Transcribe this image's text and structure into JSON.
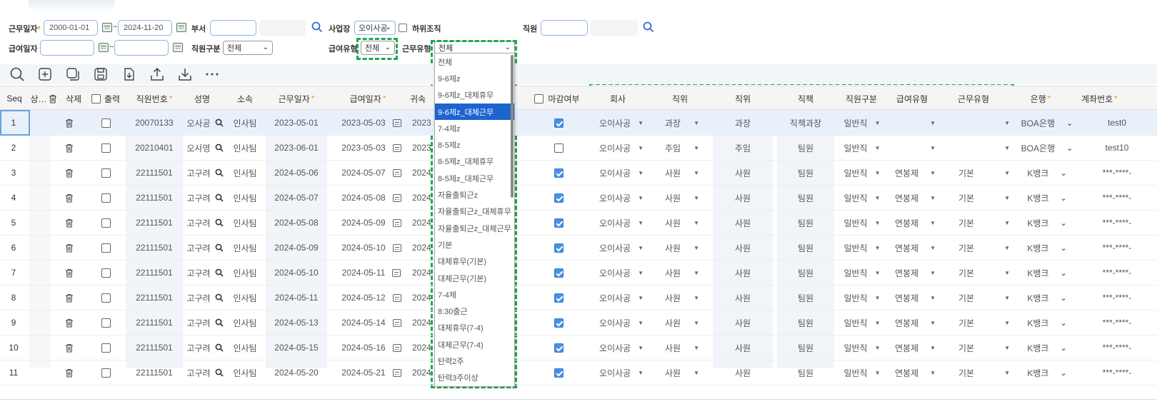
{
  "filters": {
    "work_date": {
      "label": "근무일자",
      "required_mark": "*",
      "from": "2000-01-01",
      "tilde": "~",
      "to": "2024-11-20"
    },
    "dept": {
      "label": "부서",
      "value": ""
    },
    "workplace": {
      "label": "사업장",
      "value": "오이사공"
    },
    "sub_org": {
      "label": "하위조직",
      "checked": false
    },
    "employee": {
      "label": "직원",
      "value": ""
    },
    "pay_date": {
      "label": "급여일자",
      "from": "",
      "tilde": "~",
      "to": ""
    },
    "emp_type": {
      "label": "직원구분",
      "value": "전체"
    },
    "pay_type": {
      "label": "급여유형",
      "value": "전체"
    },
    "work_type": {
      "label": "근무유형",
      "value": "전체"
    }
  },
  "toolbar": {
    "icons": [
      "search-icon",
      "add-icon",
      "copy-icon",
      "save-icon",
      "download-file-icon",
      "upload-icon",
      "download-icon",
      "more-icon"
    ]
  },
  "grid": {
    "headers": {
      "seq": "Seq",
      "status": "상…",
      "delete": "삭제",
      "print": "출력",
      "emp_no": "직원번호",
      "name": "성명",
      "affil": "소속",
      "work_date": "근무일자",
      "pay_date": "급여일자",
      "attrib": "귀속",
      "closed": "마감여부",
      "company": "회사",
      "position": "직위",
      "position2": "직위",
      "duty": "직책",
      "emp_type": "직원구분",
      "pay_type": "급여유형",
      "work_type": "근무유형",
      "bank": "은행",
      "account": "계좌번호"
    },
    "star": "*",
    "rows": [
      {
        "seq": "1",
        "emp_no": "20070133",
        "name": "오사공",
        "affil": "인사팀",
        "work_date": "2023-05-01",
        "pay_date": "2023-05-03",
        "attrib": "2023",
        "closed": true,
        "company": "오이사공",
        "position": "과장",
        "position2": "과장",
        "duty": "직책과장",
        "emp_type": "일반직",
        "pay_type": "",
        "work_type": "",
        "bank": "BOA은행",
        "account": "test0"
      },
      {
        "seq": "2",
        "emp_no": "20210401",
        "name": "오사영",
        "affil": "인사팀",
        "work_date": "2023-06-01",
        "pay_date": "2023-05-03",
        "attrib": "2023",
        "closed": false,
        "company": "오이사공",
        "position": "주임",
        "position2": "주임",
        "duty": "팀원",
        "emp_type": "일반직",
        "pay_type": "",
        "work_type": "",
        "bank": "BOA은행",
        "account": "test10"
      },
      {
        "seq": "3",
        "emp_no": "22111501",
        "name": "고구려",
        "affil": "인사팀",
        "work_date": "2024-05-06",
        "pay_date": "2024-05-07",
        "attrib": "2024",
        "closed": true,
        "company": "오이사공",
        "position": "사원",
        "position2": "사원",
        "duty": "팀원",
        "emp_type": "일반직",
        "pay_type": "연봉제",
        "work_type": "기본",
        "bank": "K뱅크",
        "account": "***-****-"
      },
      {
        "seq": "4",
        "emp_no": "22111501",
        "name": "고구려",
        "affil": "인사팀",
        "work_date": "2024-05-07",
        "pay_date": "2024-05-08",
        "attrib": "2024",
        "closed": true,
        "company": "오이사공",
        "position": "사원",
        "position2": "사원",
        "duty": "팀원",
        "emp_type": "일반직",
        "pay_type": "연봉제",
        "work_type": "기본",
        "bank": "K뱅크",
        "account": "***-****-"
      },
      {
        "seq": "5",
        "emp_no": "22111501",
        "name": "고구려",
        "affil": "인사팀",
        "work_date": "2024-05-08",
        "pay_date": "2024-05-09",
        "attrib": "2024",
        "closed": true,
        "company": "오이사공",
        "position": "사원",
        "position2": "사원",
        "duty": "팀원",
        "emp_type": "일반직",
        "pay_type": "연봉제",
        "work_type": "기본",
        "bank": "K뱅크",
        "account": "***-****-"
      },
      {
        "seq": "6",
        "emp_no": "22111501",
        "name": "고구려",
        "affil": "인사팀",
        "work_date": "2024-05-09",
        "pay_date": "2024-05-10",
        "attrib": "2024",
        "closed": true,
        "company": "오이사공",
        "position": "사원",
        "position2": "사원",
        "duty": "팀원",
        "emp_type": "일반직",
        "pay_type": "연봉제",
        "work_type": "기본",
        "bank": "K뱅크",
        "account": "***-****-"
      },
      {
        "seq": "7",
        "emp_no": "22111501",
        "name": "고구려",
        "affil": "인사팀",
        "work_date": "2024-05-10",
        "pay_date": "2024-05-11",
        "attrib": "2024",
        "closed": true,
        "company": "오이사공",
        "position": "사원",
        "position2": "사원",
        "duty": "팀원",
        "emp_type": "일반직",
        "pay_type": "연봉제",
        "work_type": "기본",
        "bank": "K뱅크",
        "account": "***-****-"
      },
      {
        "seq": "8",
        "emp_no": "22111501",
        "name": "고구려",
        "affil": "인사팀",
        "work_date": "2024-05-11",
        "pay_date": "2024-05-12",
        "attrib": "2024",
        "closed": true,
        "company": "오이사공",
        "position": "사원",
        "position2": "사원",
        "duty": "팀원",
        "emp_type": "일반직",
        "pay_type": "연봉제",
        "work_type": "기본",
        "bank": "K뱅크",
        "account": "***-****-"
      },
      {
        "seq": "9",
        "emp_no": "22111501",
        "name": "고구려",
        "affil": "인사팀",
        "work_date": "2024-05-13",
        "pay_date": "2024-05-14",
        "attrib": "2024",
        "closed": true,
        "company": "오이사공",
        "position": "사원",
        "position2": "사원",
        "duty": "팀원",
        "emp_type": "일반직",
        "pay_type": "연봉제",
        "work_type": "기본",
        "bank": "K뱅크",
        "account": "***-****-"
      },
      {
        "seq": "10",
        "emp_no": "22111501",
        "name": "고구려",
        "affil": "인사팀",
        "work_date": "2024-05-15",
        "pay_date": "2024-05-16",
        "attrib": "2024",
        "closed": true,
        "company": "오이사공",
        "position": "사원",
        "position2": "사원",
        "duty": "팀원",
        "emp_type": "일반직",
        "pay_type": "연봉제",
        "work_type": "기본",
        "bank": "K뱅크",
        "account": "***-****-"
      },
      {
        "seq": "11",
        "emp_no": "22111501",
        "name": "고구려",
        "affil": "인사팀",
        "work_date": "2024-05-20",
        "pay_date": "2024-05-21",
        "attrib": "2024",
        "closed": true,
        "company": "오이사공",
        "position": "사원",
        "position2": "사원",
        "duty": "팀원",
        "emp_type": "일반직",
        "pay_type": "연봉제",
        "work_type": "기본",
        "bank": "K뱅크",
        "account": "***-****-"
      }
    ]
  },
  "dropdown": {
    "selected": "9-6제z_대체근무",
    "options": [
      "전체",
      "9-6제z",
      "9-6제z_대체휴무",
      "9-6제z_대체근무",
      "7-4제z",
      "8-5제z",
      "8-5제z_대체휴무",
      "8-5제z_대체근무",
      "자율출퇴근z",
      "자율출퇴근z_대체휴무",
      "자율출퇴근z_대체근무",
      "기본",
      "대체휴무(기본)",
      "대체근무(기본)",
      "7-4제",
      "8:30출근",
      "대체휴무(7-4)",
      "대체근무(7-4)",
      "탄력2주",
      "탄력3주이상"
    ]
  },
  "colors": {
    "highlight": "#1aaa50",
    "selected_option": "#1e64d0",
    "checkbox": "#4a90e2",
    "required": "#f0a500"
  }
}
